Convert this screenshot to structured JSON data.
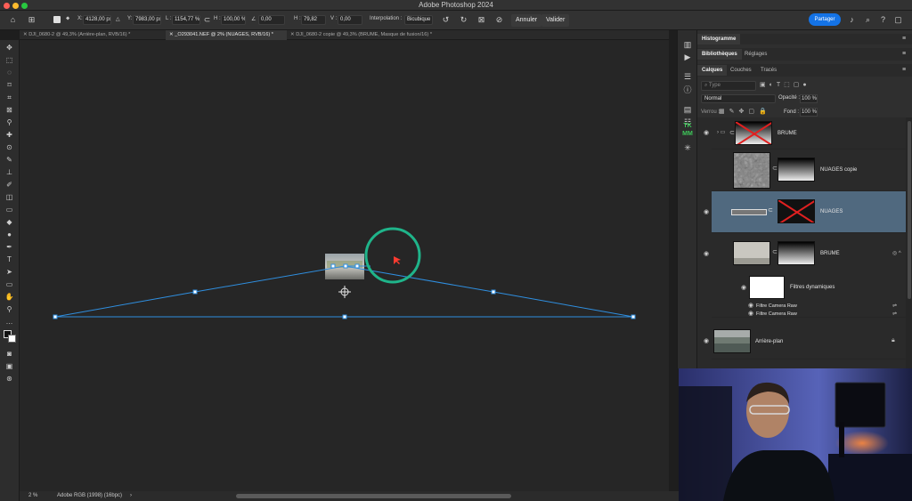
{
  "app": {
    "title": "Adobe Photoshop 2024"
  },
  "options_bar": {
    "x_label": "X:",
    "x_value": "4128,00 px",
    "y_label": "Y:",
    "y_value": "7983,00 px",
    "w_label": "L :",
    "w_value": "1154,77 %",
    "h_label": "H :",
    "h_value": "100,00 %",
    "angle_value": "0,00",
    "hskew_label": "H :",
    "hskew_value": "79,82",
    "vskew_label": "V :",
    "vskew_value": "0,00",
    "interp_label": "Interpolation :",
    "interp_value": "Bicubique",
    "cancel_label": "Annuler",
    "commit_label": "Valider",
    "share_label": "Partager"
  },
  "doc_tabs": [
    {
      "label": "DJI_0680-2 @ 49,3% (Arrière-plan, RVB/16) *"
    },
    {
      "label": "_O293041.NEF @ 2% (NUAGES, RVB/16) *"
    },
    {
      "label": "DJI_0680-2 copie @ 49,3% (BRUME, Masque de fusion/16) *"
    }
  ],
  "status": {
    "zoom": "2 %",
    "profile": "Adobe RGB (1998) (16bpc)",
    "arrow": "›"
  },
  "panels": {
    "top_tabs": [
      "Histogramme"
    ],
    "mid_tabs": [
      "Bibliothèques",
      "Réglages"
    ],
    "layer_tabs": [
      "Calques",
      "Couches",
      "Tracés"
    ],
    "filter_placeholder": "Type",
    "blend_mode": "Normal",
    "opacity_label": "Opacité :",
    "opacity_value": "100 %",
    "lock_label": "Verrou :",
    "fill_label": "Fond :",
    "fill_value": "100 %"
  },
  "layers": {
    "brume_group": "BRUME",
    "nuages_copie": "NUAGES copie",
    "nuages": "NUAGES",
    "brume": "BRUME",
    "smart_filters": "Filtres dynamiques",
    "filter1": "Filtre Camera Raw",
    "filter2": "Filtre Camera Raw",
    "background": "Arrière-plan"
  },
  "toolbar_icons": [
    "move-tool-icon",
    "marquee-icon",
    "lasso-icon",
    "object-select-icon",
    "crop-icon",
    "eyedropper-icon",
    "heal-icon",
    "brush-icon",
    "stamp-icon",
    "history-brush-icon",
    "eraser-icon",
    "gradient-icon",
    "blur-icon",
    "dodge-icon",
    "pen-icon",
    "type-icon",
    "path-select-icon",
    "shape-icon",
    "hand-icon",
    "zoom-icon"
  ],
  "colors": {
    "accent": "#1473e6",
    "selection": "#50697f",
    "warp_line": "#2f8fe0",
    "cursor_ring": "#1fb48a"
  }
}
